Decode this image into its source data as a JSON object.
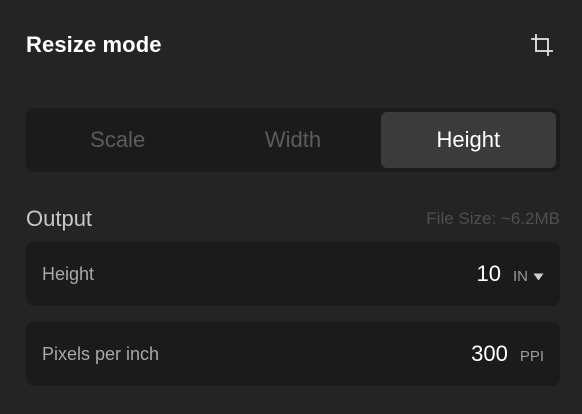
{
  "header": {
    "title": "Resize mode",
    "crop_icon": "crop-icon"
  },
  "modes": {
    "items": [
      {
        "label": "Scale",
        "active": false
      },
      {
        "label": "Width",
        "active": false
      },
      {
        "label": "Height",
        "active": true
      }
    ]
  },
  "output": {
    "title": "Output",
    "file_size": "File Size: ~6.2MB"
  },
  "fields": {
    "height": {
      "label": "Height",
      "value": "10",
      "unit": "IN",
      "unit_icon": "caret-down-icon"
    },
    "ppi": {
      "label": "Pixels per inch",
      "value": "300",
      "unit": "PPI"
    }
  }
}
